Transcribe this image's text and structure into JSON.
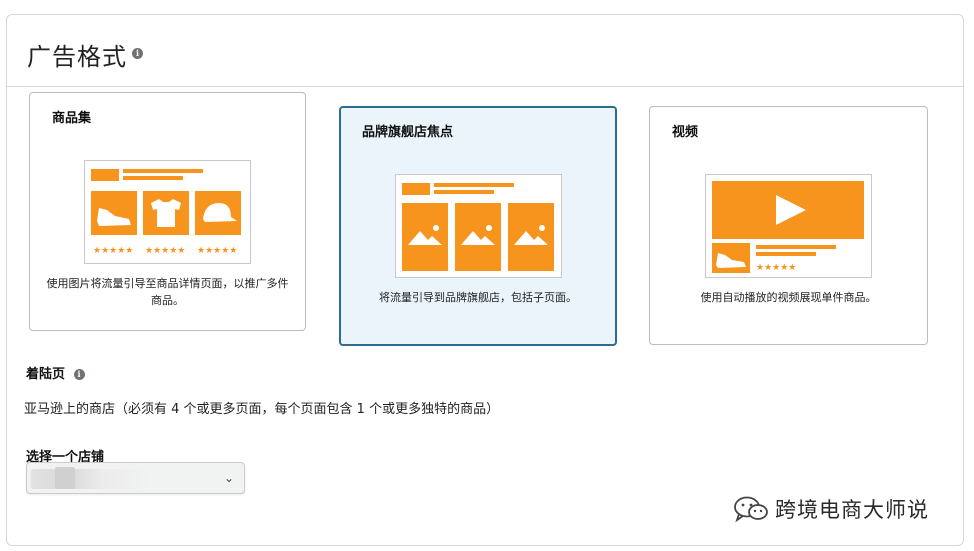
{
  "header": {
    "title": "广告格式",
    "info_icon": "info-icon"
  },
  "cards": [
    {
      "title": "商品集",
      "description": "使用图片将流量引导至商品详情页面，以推广多件商品。",
      "selected": false
    },
    {
      "title": "品牌旗舰店焦点",
      "description": "将流量引导到品牌旗舰店，包括子页面。",
      "selected": true
    },
    {
      "title": "视频",
      "description": "使用自动播放的视频展现单件商品。",
      "selected": false
    }
  ],
  "landing": {
    "label": "着陆页",
    "text": "亚马逊上的商店（必须有 4 个或更多页面，每个页面包含 1 个或更多独特的商品）"
  },
  "store_select": {
    "label": "选择一个店铺",
    "value": ""
  },
  "watermark": {
    "text": "跨境电商大师说",
    "icon": "wechat-icon"
  },
  "colors": {
    "accent_orange": "#f7941d",
    "selected_bg": "#ebf4fb",
    "selected_border": "#2c6e8f",
    "star": "#f7941d"
  }
}
